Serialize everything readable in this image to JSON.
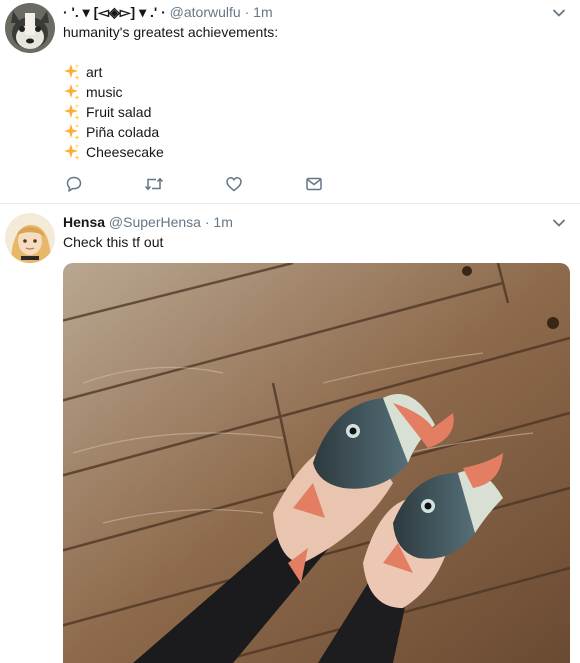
{
  "tweets": [
    {
      "display_name": "· '. ▾ [◅◈▻] ▾ .' ·",
      "handle": "@atorwulfu",
      "separator": "·",
      "time": "1m",
      "text": "humanity's greatest achievements:",
      "list": [
        "art",
        "music",
        "Fruit salad",
        "Piña colada",
        "Cheesecake"
      ],
      "list_icon": "sparkles-icon",
      "actions": [
        "reply-icon",
        "retweet-icon",
        "like-icon",
        "direct-message-icon"
      ]
    },
    {
      "display_name": "Hensa",
      "handle": "@SuperHensa",
      "separator": "·",
      "time": "1m",
      "text": "Check this tf out",
      "media": "photo of feet wearing fish-shaped sandals on a wooden floor"
    }
  ],
  "colors": {
    "text": "#14171a",
    "secondary": "#657786",
    "divider": "#e6ecf0",
    "sparkle": "#ffac33"
  }
}
